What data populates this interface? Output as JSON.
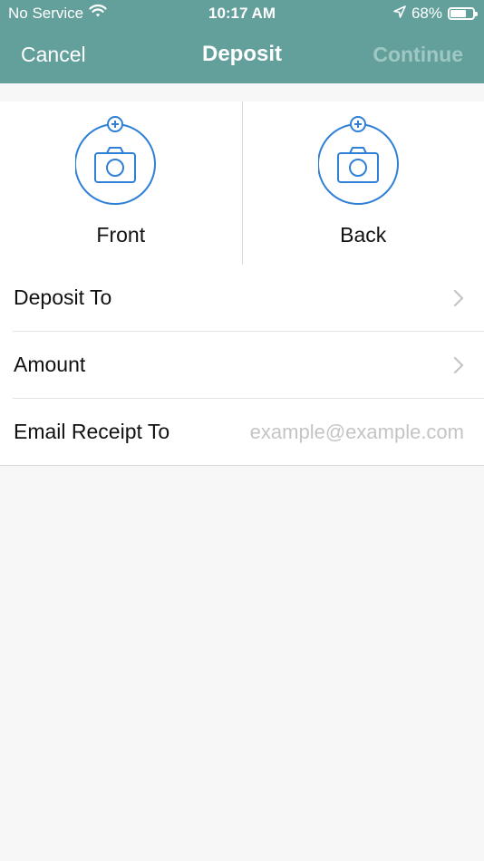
{
  "status_bar": {
    "carrier": "No Service",
    "time": "10:17 AM",
    "battery": "68%",
    "icons": [
      "wifi-icon",
      "location-arrow-icon",
      "battery-icon"
    ]
  },
  "nav": {
    "cancel_label": "Cancel",
    "title": "Deposit",
    "continue_label": "Continue"
  },
  "capture": {
    "front_label": "Front",
    "back_label": "Back",
    "icon": "camera-add-icon"
  },
  "form": {
    "rows": [
      {
        "label": "Deposit To",
        "icon": "chevron-right-icon"
      },
      {
        "label": "Amount",
        "icon": "chevron-right-icon"
      },
      {
        "label": "Email Receipt To",
        "placeholder": "example@example.com",
        "value": ""
      }
    ]
  },
  "colors": {
    "header": "#64a09b",
    "accent_blue": "#2f80d6",
    "continue_disabled": "#9fc8c4",
    "background": "#f7f7f7"
  }
}
